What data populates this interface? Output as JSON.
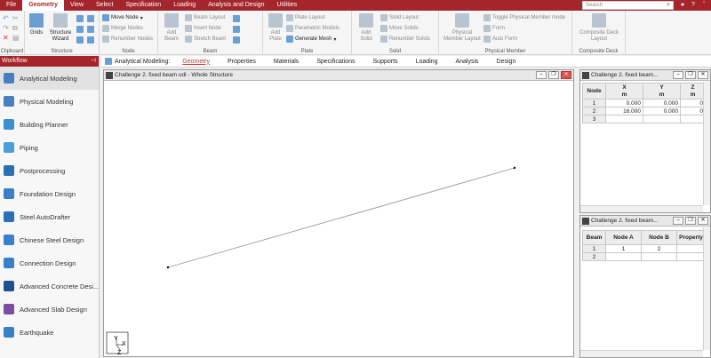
{
  "menu": {
    "items": [
      "File",
      "Geometry",
      "View",
      "Select",
      "Specification",
      "Loading",
      "Analysis and Design",
      "Utilities"
    ],
    "active": "Geometry",
    "search_placeholder": "Search"
  },
  "ribbon": {
    "clipboard": {
      "label": "Clipboard"
    },
    "structure": {
      "label": "Structure",
      "grids": "Grids",
      "wizard": "Structure Wizard"
    },
    "node": {
      "label": "Node",
      "move": "Move Node",
      "merge": "Merge Nodes",
      "renumber": "Renumber Nodes"
    },
    "beam": {
      "label": "Beam",
      "add": "Add Beam",
      "layout": "Beam Layout",
      "insert": "Insert Node",
      "stretch": "Stretch Beam"
    },
    "plate": {
      "label": "Plate",
      "add": "Add Plate",
      "layout": "Plate Layout",
      "parametric": "Parametric Models",
      "mesh": "Generate Mesh"
    },
    "solid": {
      "label": "Solid",
      "add": "Add Solid",
      "layout": "Solid Layout",
      "move": "Move Solids",
      "renumber": "Renumber Solids"
    },
    "physical": {
      "label": "Physical Member",
      "layout": "Physical Member Layout",
      "toggle": "Toggle Physical Member mode",
      "form": "Form",
      "auto": "Auto Form"
    },
    "composite": {
      "label": "Composite Deck",
      "layout": "Composite Deck Layout"
    }
  },
  "workflow": {
    "title": "Workflow",
    "items": [
      {
        "label": "Analytical Modeling",
        "color": "#4a7fbf"
      },
      {
        "label": "Physical Modeling",
        "color": "#4a7fbf"
      },
      {
        "label": "Building Planner",
        "color": "#3a8fd0"
      },
      {
        "label": "Piping",
        "color": "#4a9fd8"
      },
      {
        "label": "Postprocessing",
        "color": "#2a6fb0"
      },
      {
        "label": "Foundation Design",
        "color": "#3a80c8"
      },
      {
        "label": "Steel AutoDrafter",
        "color": "#2a70b8"
      },
      {
        "label": "Chinese Steel Design",
        "color": "#3a80c8"
      },
      {
        "label": "Connection Design",
        "color": "#3a80c8"
      },
      {
        "label": "Advanced Concrete Desi...",
        "color": "#1f4f8f"
      },
      {
        "label": "Advanced Slab Design",
        "color": "#7a4fa0"
      },
      {
        "label": "Earthquake",
        "color": "#3a80c8"
      }
    ]
  },
  "pagecontrol": {
    "title": "Analytical Modeling:",
    "tabs": [
      "Geometry",
      "Properties",
      "Materials",
      "Specifications",
      "Supports",
      "Loading",
      "Analysis",
      "Design"
    ],
    "active": "Geometry"
  },
  "view": {
    "title": "Challenge 2. fixed beam udl - Whole Structure",
    "axis": {
      "y": "Y",
      "x": "X",
      "z": "Z"
    }
  },
  "node_table": {
    "title": "Challenge 2. fixed beam...",
    "headers": [
      "Node",
      "X",
      "Y",
      "Z"
    ],
    "units": [
      "",
      "m",
      "m",
      "m"
    ],
    "rows": [
      {
        "n": "1",
        "x": "0.000",
        "y": "0.000",
        "z": "0"
      },
      {
        "n": "2",
        "x": "16.000",
        "y": "0.000",
        "z": "0"
      },
      {
        "n": "3",
        "x": "",
        "y": "",
        "z": ""
      }
    ]
  },
  "beam_table": {
    "title": "Challenge 2. fixed beam...",
    "headers": [
      "Beam",
      "Node A",
      "Node B",
      "Property"
    ],
    "rows": [
      {
        "b": "1",
        "a": "1",
        "bb": "2",
        "p": ""
      },
      {
        "b": "2",
        "a": "",
        "bb": "",
        "p": ""
      }
    ]
  }
}
